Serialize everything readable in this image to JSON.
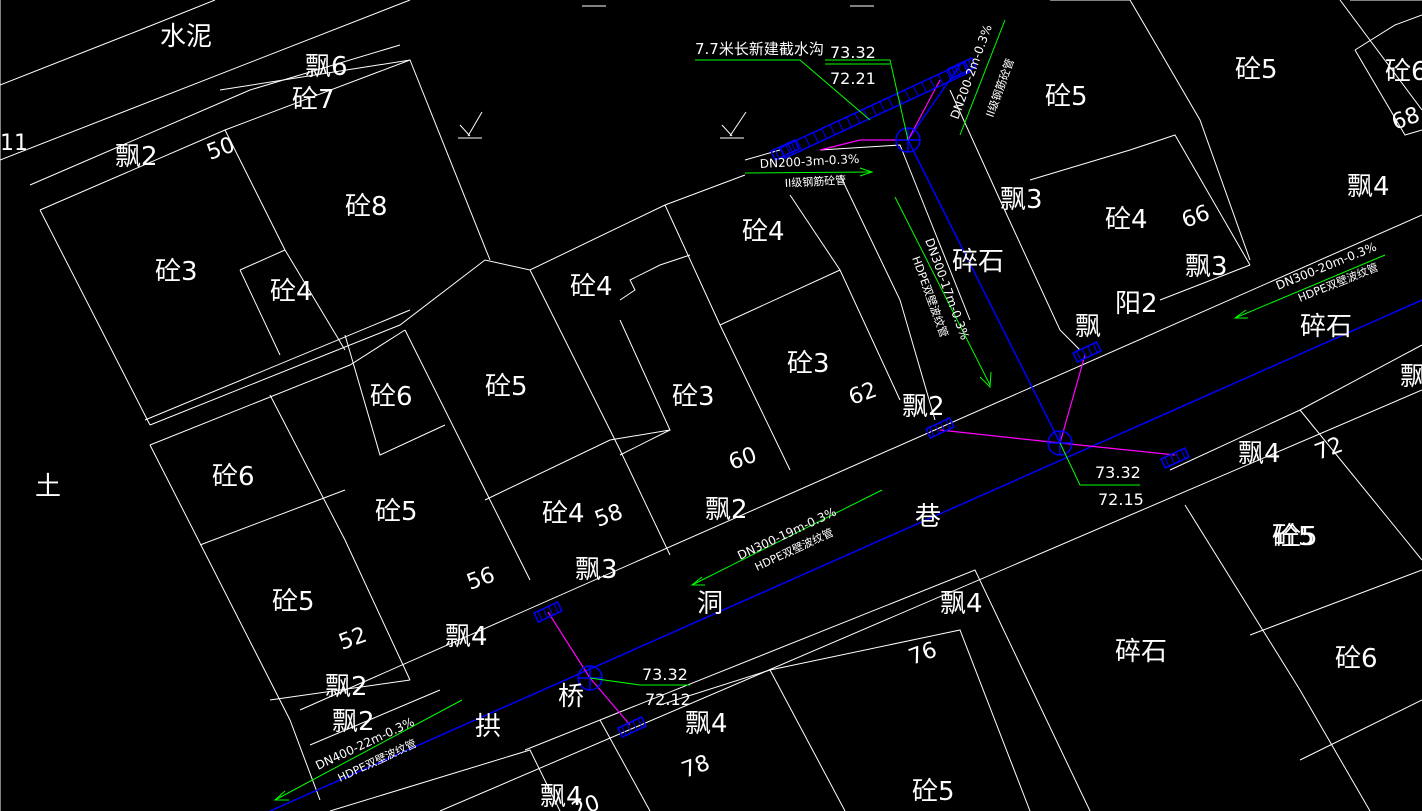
{
  "colors": {
    "background": "#000000",
    "parcel_line": "#ffffff",
    "pipe": "#0000ff",
    "manhole": "#0000ff",
    "leader": "#00ff00",
    "connector": "#ff00ff",
    "text": "#ffffff",
    "pipe_label": "#ffffff"
  },
  "icons": {
    "manhole": "circle-cross-icon",
    "catch_basin": "hatched-rectangle-icon",
    "flow_arrow": "arrow-icon",
    "vegetation": "vegetation-symbol-icon"
  },
  "parcel_labels": [
    "水泥",
    "飘6",
    "砼7",
    "飘2",
    "50",
    "砼8",
    "砼3",
    "砼4",
    "砼4",
    "砼5",
    "砼6",
    "砼5",
    "砼3",
    "砼3",
    "砼4",
    "62",
    "60",
    "砼6",
    "砼5",
    "砼4",
    "58",
    "飘2",
    "飘3",
    "56",
    "砼5",
    "52",
    "飘4",
    "飘2",
    "飘2",
    "土",
    "11",
    "砼5",
    "砼5",
    "砼6",
    "68",
    "飘3",
    "砼4",
    "66",
    "飘3",
    "飘4",
    "阳2",
    "飘",
    "碎石",
    "飘2",
    "飘4",
    "72",
    "砼5",
    "碎石",
    "砼6",
    "飘4",
    "76",
    "飘4",
    "78",
    "飘4",
    "砼5",
    "20",
    "巷",
    "洞",
    "桥",
    "拱",
    "碎石",
    "飘"
  ],
  "elevations": [
    {
      "top": "73.32",
      "bottom": "72.21"
    },
    {
      "top": "73.32",
      "bottom": "72.15"
    },
    {
      "top": "73.32",
      "bottom": "72.12"
    }
  ],
  "pipe_labels": [
    {
      "line1": "DN200-3m-0.3%",
      "line2": "II级钢筋砼管"
    },
    {
      "line1": "DN200-2m-0.3%",
      "line2": "II级钢筋砼管"
    },
    {
      "line1": "DN300-17m-0.3%",
      "line2": "HDPE双壁波纹管"
    },
    {
      "line1": "DN300-20m-0.3%",
      "line2": "HDPE双壁波纹管"
    },
    {
      "line1": "DN300-19m-0.3%",
      "line2": "HDPE双壁波纹管"
    },
    {
      "line1": "DN400-22m-0.3%",
      "line2": "HDPE双壁波纹管"
    }
  ],
  "ditch_note": "7.7米长新建截水沟"
}
